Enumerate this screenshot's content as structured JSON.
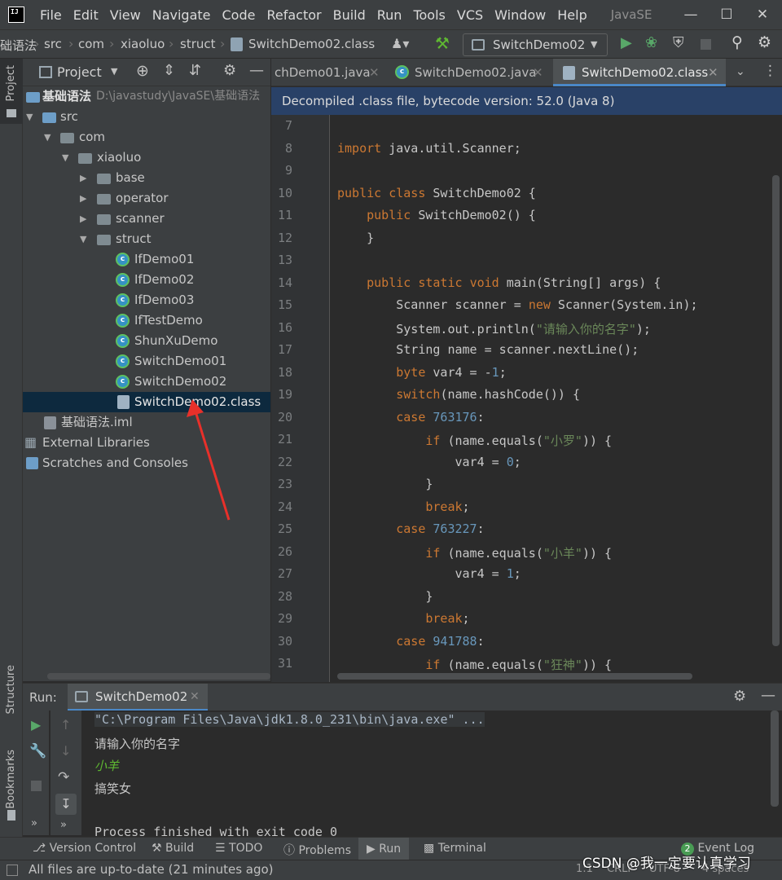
{
  "menu": {
    "items": [
      "File",
      "Edit",
      "View",
      "Navigate",
      "Code",
      "Refactor",
      "Build",
      "Run",
      "Tools",
      "VCS",
      "Window",
      "Help"
    ],
    "project_title": "JavaSE",
    "logo_text": "IJ"
  },
  "navbar": {
    "breadcrumbs": [
      "础语法",
      "src",
      "com",
      "xiaoluo",
      "struct",
      "SwitchDemo02.class"
    ],
    "run_config": "SwitchDemo02"
  },
  "left_strip": {
    "project": "Project",
    "structure": "Structure",
    "bookmarks": "Bookmarks"
  },
  "project_panel": {
    "title": "Project",
    "root_name": "基础语法",
    "root_path": "D:\\javastudy\\JavaSE\\基础语法",
    "tree": [
      "src",
      "com",
      "xiaoluo",
      "base",
      "operator",
      "scanner",
      "struct",
      "IfDemo01",
      "IfDemo02",
      "IfDemo03",
      "IfTestDemo",
      "ShunXuDemo",
      "SwitchDemo01",
      "SwitchDemo02",
      "SwitchDemo02.class",
      "基础语法.iml",
      "External Libraries",
      "Scratches and Consoles"
    ]
  },
  "editor": {
    "tabs": [
      "chDemo01.java",
      "SwitchDemo02.java",
      "SwitchDemo02.class"
    ],
    "banner": "Decompiled .class file, bytecode version: 52.0 (Java 8)",
    "line_numbers": [
      "7",
      "8",
      "9",
      "10",
      "11",
      "12",
      "13",
      "14",
      "15",
      "16",
      "17",
      "18",
      "19",
      "20",
      "21",
      "22",
      "23",
      "24",
      "25",
      "26",
      "27",
      "28",
      "29",
      "30",
      "31"
    ],
    "lines": [
      "",
      "import java.util.Scanner;",
      "",
      "public class SwitchDemo02 {",
      "    public SwitchDemo02() {",
      "    }",
      "",
      "    public static void main(String[] args) {",
      "        Scanner scanner = new Scanner(System.in);",
      "        System.out.println(\"请输入你的名字\");",
      "        String name = scanner.nextLine();",
      "        byte var4 = -1;",
      "        switch(name.hashCode()) {",
      "        case 763176:",
      "            if (name.equals(\"小罗\")) {",
      "                var4 = 0;",
      "            }",
      "            break;",
      "        case 763227:",
      "            if (name.equals(\"小羊\")) {",
      "                var4 = 1;",
      "            }",
      "            break;",
      "        case 941788:",
      "            if (name.equals(\"狂神\")) {"
    ]
  },
  "run_panel": {
    "label": "Run:",
    "tab": "SwitchDemo02",
    "output": [
      {
        "text": "\"C:\\Program Files\\Java\\jdk1.8.0_231\\bin\\java.exe\" ...",
        "kind": "cmd"
      },
      {
        "text": "请输入你的名字",
        "kind": "normal"
      },
      {
        "text": "小羊",
        "kind": "input"
      },
      {
        "text": "搞笑女",
        "kind": "normal"
      },
      {
        "text": "",
        "kind": "normal"
      },
      {
        "text": "Process finished with exit code 0",
        "kind": "normal"
      }
    ]
  },
  "toolwindows": {
    "version_control": "Version Control",
    "build": "Build",
    "todo": "TODO",
    "problems": "Problems",
    "run": "Run",
    "terminal": "Terminal",
    "event_log": "Event Log",
    "event_count": "2"
  },
  "status": {
    "message": "All files are up-to-date (21 minutes ago)",
    "position": "1:1",
    "line_sep": "CRLF",
    "encoding": "UTF-8",
    "indent": "4 spaces"
  },
  "watermark": "CSDN @我一定要认真学习",
  "colors": {
    "keyword": "#cc7832",
    "string": "#6a8759",
    "number": "#6897bb",
    "accent": "#4a88c7",
    "annotation_arrow": "#e8302a"
  }
}
